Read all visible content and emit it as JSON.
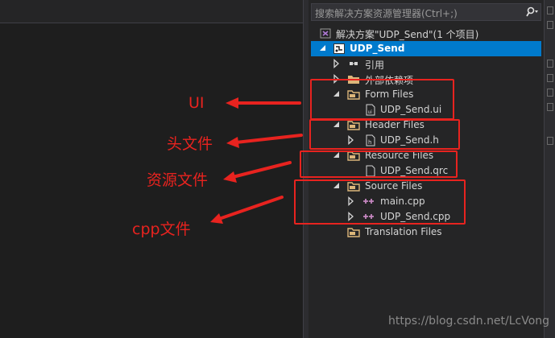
{
  "search": {
    "placeholder": "搜索解决方案资源管理器(Ctrl+;)"
  },
  "tree": {
    "solution_label": "解决方案\"UDP_Send\"(1 个项目)",
    "project_label": "UDP_Send",
    "references_label": "引用",
    "external_deps_label": "外部依赖项",
    "form_files": {
      "label": "Form Files",
      "file": "UDP_Send.ui"
    },
    "header_files": {
      "label": "Header Files",
      "file": "UDP_Send.h"
    },
    "resource_files": {
      "label": "Resource Files",
      "file": "UDP_Send.qrc"
    },
    "source_files": {
      "label": "Source Files",
      "files": [
        "main.cpp",
        "UDP_Send.cpp"
      ]
    },
    "translation_files": {
      "label": "Translation Files"
    }
  },
  "annotations": {
    "ui": "UI",
    "header": "头文件",
    "resource": "资源文件",
    "cpp": "cpp文件"
  },
  "watermark": "https://blog.csdn.net/LcVong",
  "colors": {
    "accent": "#007acc",
    "annotation": "#e8231f",
    "folder": "#dcb67a",
    "cpp": "#c586c0"
  }
}
